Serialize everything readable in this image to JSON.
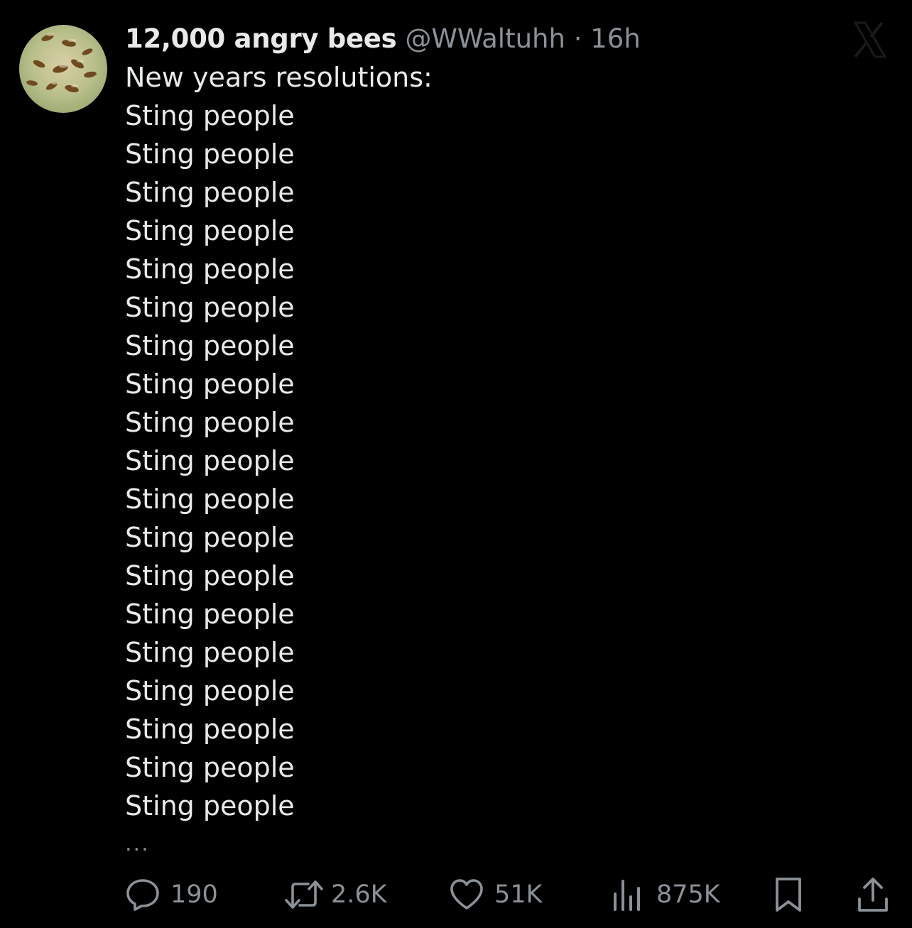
{
  "tweet": {
    "author_name": "12,000 angry bees",
    "handle": "@WWaltuhh",
    "separator": "·",
    "time": "16h",
    "first_line": "New years resolutions:",
    "lines": [
      "Sting people",
      "Sting people",
      "Sting people",
      "Sting people",
      "Sting people",
      "Sting people",
      "Sting people",
      "Sting people",
      "Sting people",
      "Sting people",
      "Sting people",
      "Sting people",
      "Sting people",
      "Sting people",
      "Sting people",
      "Sting people",
      "Sting people",
      "Sting people",
      "Sting people"
    ],
    "ellipsis": "..."
  },
  "actions": {
    "replies": "190",
    "reposts": "2.6K",
    "likes": "51K",
    "views": "875K"
  },
  "icons": {
    "avatar": "bees-photo-avatar",
    "watermark": "x-logo-icon",
    "reply": "reply-bubble-icon",
    "repost": "repost-arrows-icon",
    "like": "heart-icon",
    "views": "bar-chart-icon",
    "bookmark": "bookmark-icon",
    "share": "share-upload-icon"
  },
  "colors": {
    "background": "#000000",
    "primary_text": "#e7e9ea",
    "secondary_text": "#8b9197"
  }
}
